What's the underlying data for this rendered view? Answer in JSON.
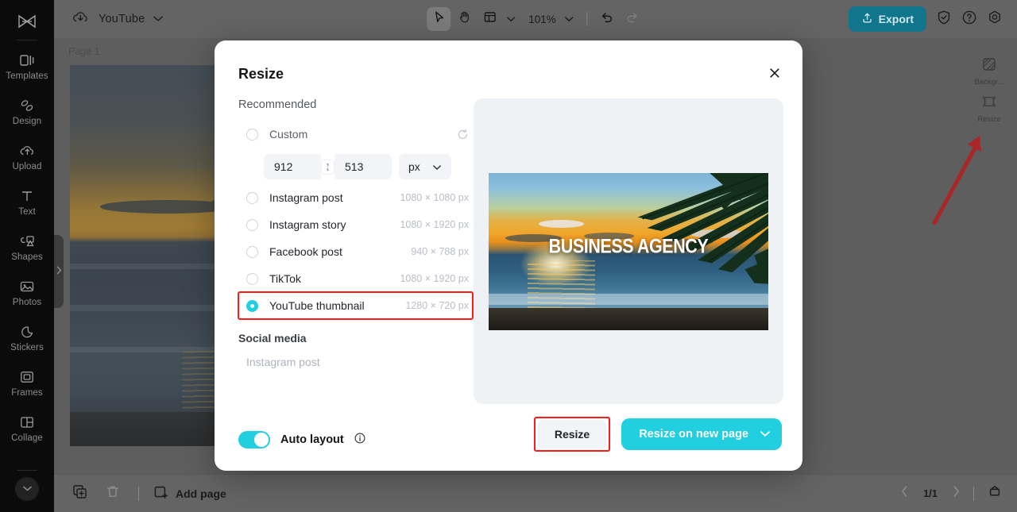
{
  "app": {
    "accent_cyan": "#21cfe0",
    "export_bg": "#11758b",
    "highlight_red": "#ff1a1a"
  },
  "topbar": {
    "cloud_icon": "cloud-sync-icon",
    "project_name": "YouTube",
    "project_chevron": "chevron-down-icon",
    "tools": [
      {
        "name": "select-tool",
        "icon": "cursor-icon",
        "active": true
      },
      {
        "name": "hand-tool",
        "icon": "hand-icon",
        "active": false
      },
      {
        "name": "layout-tool",
        "icon": "layout-icon",
        "active": false
      }
    ],
    "zoom_value": "101%",
    "zoom_chevron": "chevron-down-icon",
    "undo_icon": "undo-icon",
    "redo_icon": "redo-icon",
    "export_label": "Export",
    "export_icon": "upload-icon",
    "right_icons": [
      "shield-check-icon",
      "help-circle-icon",
      "settings-gear-icon"
    ]
  },
  "sidebar": {
    "logo": "capcut-logo-icon",
    "items": [
      {
        "label": "Templates",
        "icon": "templates-icon"
      },
      {
        "label": "Design",
        "icon": "design-icon"
      },
      {
        "label": "Upload",
        "icon": "upload-cloud-icon"
      },
      {
        "label": "Text",
        "icon": "text-icon"
      },
      {
        "label": "Shapes",
        "icon": "shapes-icon"
      },
      {
        "label": "Photos",
        "icon": "photos-icon"
      },
      {
        "label": "Stickers",
        "icon": "stickers-icon"
      },
      {
        "label": "Frames",
        "icon": "frames-icon"
      },
      {
        "label": "Collage",
        "icon": "collage-icon"
      }
    ],
    "expand_icon": "chevron-down-icon",
    "collapse_handle_icon": "chevron-right-icon"
  },
  "canvas": {
    "page_label": "Page 1",
    "right_panel": [
      {
        "label": "Backgr...",
        "icon": "background-icon"
      },
      {
        "label": "Resize",
        "icon": "resize-icon"
      }
    ],
    "annotation_arrow": "red-arrow-pointing-to-resize"
  },
  "bottombar": {
    "duplicate_icon": "duplicate-page-icon",
    "delete_icon": "trash-icon",
    "add_page_label": "Add page",
    "add_page_icon": "add-page-icon",
    "prev_icon": "chevron-left-icon",
    "next_icon": "chevron-right-icon",
    "page_indicator": "1/1",
    "grid_icon": "page-grid-icon"
  },
  "modal": {
    "title": "Resize",
    "close_icon": "close-icon",
    "recommended_label": "Recommended",
    "custom": {
      "label": "Custom",
      "selected": false,
      "reset_icon": "reset-icon",
      "width": "912",
      "height": "513",
      "link_icon": "link-ratio-icon",
      "unit": "px",
      "unit_chevron": "chevron-down-icon"
    },
    "presets": [
      {
        "label": "Instagram post",
        "dimensions": "1080 × 1080 px",
        "selected": false,
        "highlighted": false
      },
      {
        "label": "Instagram story",
        "dimensions": "1080 × 1920 px",
        "selected": false,
        "highlighted": false
      },
      {
        "label": "Facebook post",
        "dimensions": "940 × 788 px",
        "selected": false,
        "highlighted": false
      },
      {
        "label": "TikTok",
        "dimensions": "1080 × 1920 px",
        "selected": false,
        "highlighted": false
      },
      {
        "label": "YouTube thumbnail",
        "dimensions": "1280 × 720 px",
        "selected": true,
        "highlighted": true
      }
    ],
    "social_media_label": "Social media",
    "social_media_item": "Instagram post",
    "auto_layout": {
      "label": "Auto layout",
      "on": true,
      "info_icon": "info-icon"
    },
    "preview": {
      "thumbnail_text": "BUSINESS AGENCY"
    },
    "actions": {
      "secondary_label": "Resize",
      "secondary_highlighted": true,
      "primary_label": "Resize on new page",
      "primary_chevron": "chevron-down-icon"
    }
  }
}
